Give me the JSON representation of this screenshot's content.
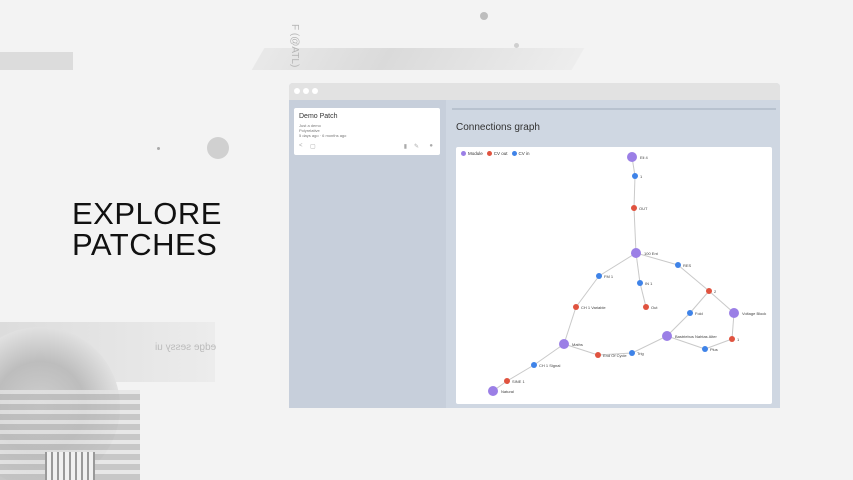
{
  "hero": {
    "line1": "EXPLORE",
    "line2": "PATCHES"
  },
  "deco": {
    "vertical_text": "F (@ATL)",
    "mirror_text": "edge sessy ui"
  },
  "window": {
    "dots": [
      "#ffffff",
      "#ffffff",
      "#ffffff"
    ]
  },
  "patch_card": {
    "title": "Demo Patch",
    "subtitle": "Just a demo",
    "tag": "Polyrelative",
    "meta": "5 days ago · 6 months ago",
    "icons": [
      "share-icon",
      "copy-icon",
      "trash-icon",
      "edit-icon",
      "info-icon"
    ]
  },
  "main": {
    "title": "Connections graph"
  },
  "legend": [
    {
      "label": "Module",
      "color": "#9b7fe6"
    },
    {
      "label": "CV out",
      "color": "#e0533f"
    },
    {
      "label": "CV in",
      "color": "#3f83e8"
    }
  ],
  "graph": {
    "nodes": [
      {
        "id": "m1",
        "label": "Eli 4",
        "type": "module",
        "gx": 176,
        "gy": 10
      },
      {
        "id": "a1",
        "label": "1",
        "type": "in",
        "gx": 179,
        "gy": 29
      },
      {
        "id": "a2",
        "label": "OUT",
        "type": "out",
        "gx": 178,
        "gy": 61
      },
      {
        "id": "m2",
        "label": "100 Ent",
        "type": "module",
        "gx": 180,
        "gy": 106
      },
      {
        "id": "b1",
        "label": "FM 1",
        "type": "in",
        "gx": 143,
        "gy": 129
      },
      {
        "id": "b2",
        "label": "IN 1",
        "type": "in",
        "gx": 184,
        "gy": 136
      },
      {
        "id": "b3",
        "label": "RES",
        "type": "in",
        "gx": 222,
        "gy": 118
      },
      {
        "id": "c1",
        "label": "CH 1 Variable",
        "type": "out",
        "gx": 120,
        "gy": 160
      },
      {
        "id": "c2",
        "label": "Out",
        "type": "out",
        "gx": 190,
        "gy": 160
      },
      {
        "id": "c3",
        "label": "2",
        "type": "out",
        "gx": 253,
        "gy": 144
      },
      {
        "id": "c4",
        "label": "Fold",
        "type": "in",
        "gx": 234,
        "gy": 166
      },
      {
        "id": "m3",
        "label": "Voltage Block",
        "type": "module",
        "gx": 278,
        "gy": 166
      },
      {
        "id": "m4",
        "label": "Bastriebus Nahtas Alter",
        "type": "module",
        "gx": 211,
        "gy": 189
      },
      {
        "id": "c5",
        "label": "1",
        "type": "out",
        "gx": 276,
        "gy": 192
      },
      {
        "id": "c6",
        "label": "Plus",
        "type": "in",
        "gx": 249,
        "gy": 202
      },
      {
        "id": "m5",
        "label": "Maths",
        "type": "module",
        "gx": 108,
        "gy": 197
      },
      {
        "id": "d1",
        "label": "End Of Cycle",
        "type": "out",
        "gx": 142,
        "gy": 208
      },
      {
        "id": "d2",
        "label": "Trig",
        "type": "in",
        "gx": 176,
        "gy": 206
      },
      {
        "id": "d3",
        "label": "CH 1 Signal",
        "type": "in",
        "gx": 78,
        "gy": 218
      },
      {
        "id": "d4",
        "label": "SINE 1",
        "type": "out",
        "gx": 51,
        "gy": 234
      },
      {
        "id": "m6",
        "label": "Natural",
        "type": "module",
        "gx": 37,
        "gy": 244
      }
    ],
    "edges": [
      [
        "m1",
        "a1"
      ],
      [
        "a1",
        "a2"
      ],
      [
        "a2",
        "m2"
      ],
      [
        "m2",
        "b1"
      ],
      [
        "m2",
        "b2"
      ],
      [
        "m2",
        "b3"
      ],
      [
        "b1",
        "c1"
      ],
      [
        "b2",
        "c2"
      ],
      [
        "b3",
        "c3"
      ],
      [
        "c3",
        "c4"
      ],
      [
        "c3",
        "m3"
      ],
      [
        "m3",
        "c5"
      ],
      [
        "c5",
        "c6"
      ],
      [
        "c6",
        "m4"
      ],
      [
        "c4",
        "m4"
      ],
      [
        "m4",
        "d2"
      ],
      [
        "d2",
        "d1"
      ],
      [
        "d1",
        "m5"
      ],
      [
        "c1",
        "m5"
      ],
      [
        "m5",
        "d3"
      ],
      [
        "d3",
        "d4"
      ],
      [
        "d4",
        "m6"
      ]
    ]
  }
}
